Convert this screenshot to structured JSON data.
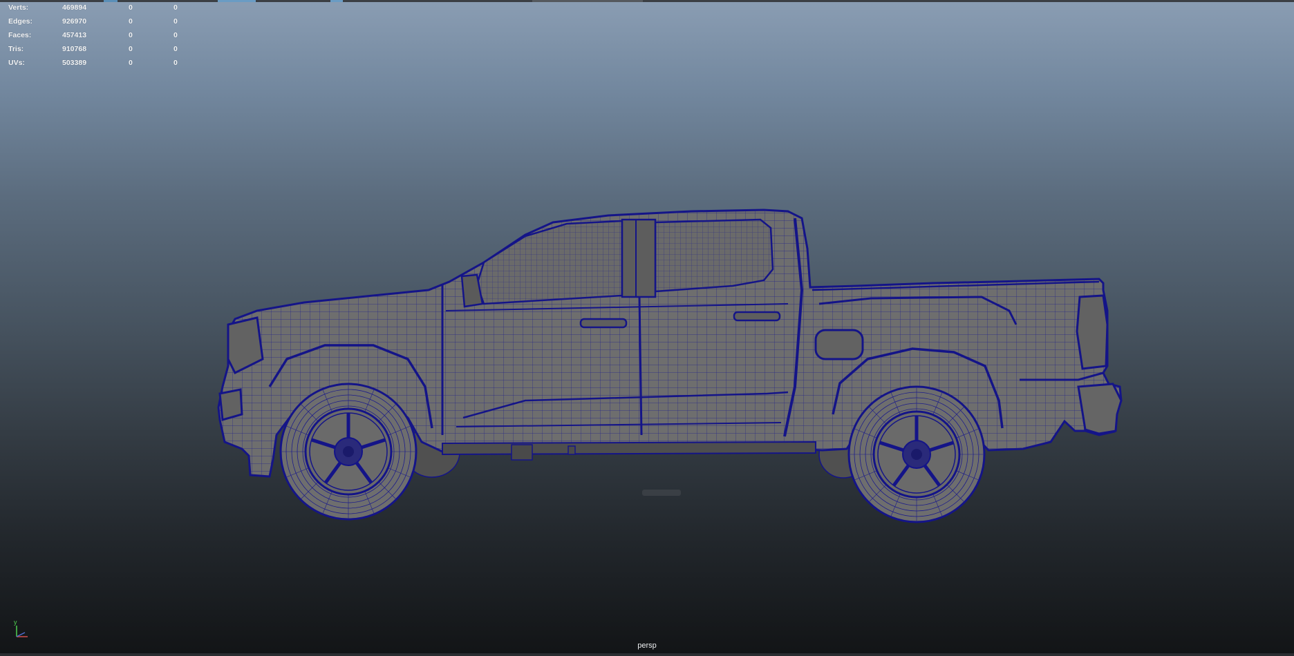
{
  "hud": {
    "rows": [
      {
        "label": "Verts:",
        "total": "469894",
        "selected": "0",
        "component": "0"
      },
      {
        "label": "Edges:",
        "total": "926970",
        "selected": "0",
        "component": "0"
      },
      {
        "label": "Faces:",
        "total": "457413",
        "selected": "0",
        "component": "0"
      },
      {
        "label": "Tris:",
        "total": "910768",
        "selected": "0",
        "component": "0"
      },
      {
        "label": "UVs:",
        "total": "503389",
        "selected": "0",
        "component": "0"
      }
    ]
  },
  "viewport": {
    "camera_name": "persp",
    "gradient_top": "#8a9db3",
    "gradient_bottom": "#121416"
  },
  "model": {
    "wire_color": "#141488",
    "shade_color": "#6e6e6e",
    "description_icon": "pickup-truck-wireframe"
  },
  "axis_gizmo": {
    "y_label": "y",
    "y_color": "#4fd14f",
    "x_color": "#d14f4f",
    "z_color": "#4f6fd1"
  }
}
